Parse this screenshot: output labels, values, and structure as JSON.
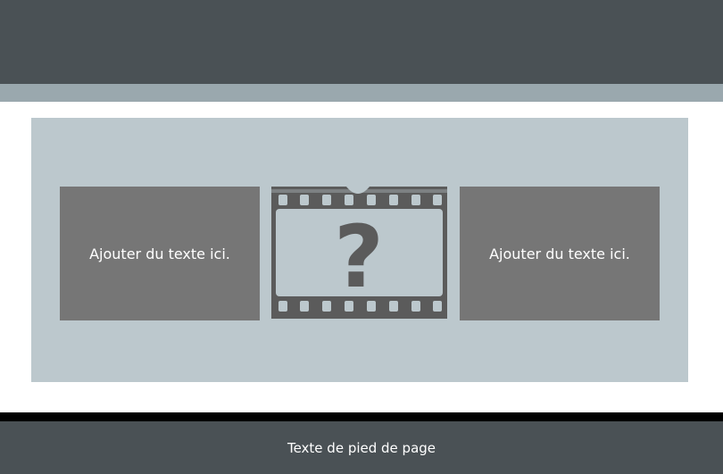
{
  "cards": {
    "left_text": "Ajouter du texte ici.",
    "right_text": "Ajouter du texte ici."
  },
  "media_placeholder": {
    "icon": "film-strip-question-icon",
    "glyph": "?"
  },
  "footer": {
    "text": "Texte de pied de page"
  },
  "colors": {
    "header": "#4a5155",
    "subbar": "#9aa8ae",
    "panel": "#bcc8cd",
    "card": "#767676",
    "footer": "#4a5155"
  }
}
